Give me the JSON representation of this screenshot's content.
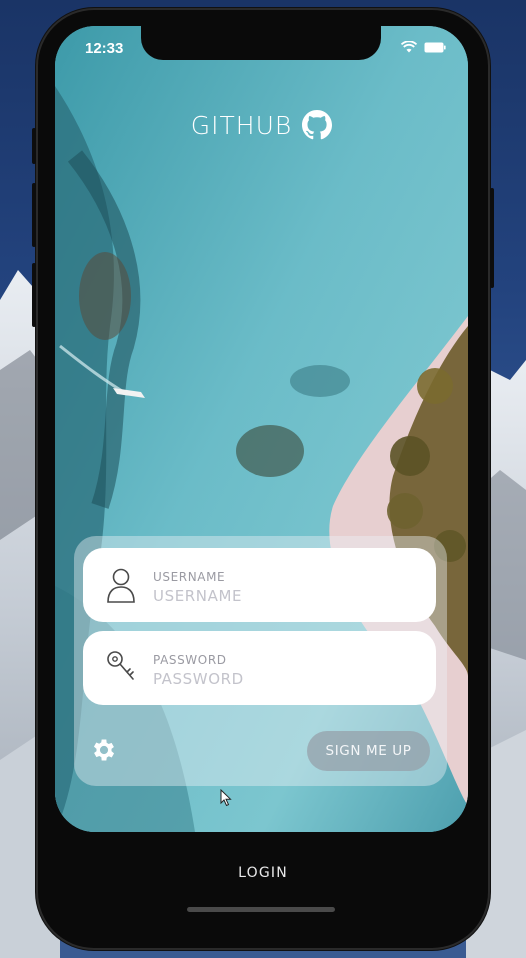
{
  "status": {
    "time": "12:33",
    "wifi_icon": "wifi-icon",
    "battery_icon": "battery-icon"
  },
  "brand": {
    "title": "GITHUB",
    "logo_icon": "github-logo-icon"
  },
  "login_form": {
    "username": {
      "label": "USERNAME",
      "placeholder": "USERNAME",
      "value": "",
      "icon": "user-icon"
    },
    "password": {
      "label": "PASSWORD",
      "placeholder": "PASSWORD",
      "value": "",
      "icon": "key-icon"
    },
    "settings_icon": "gear-icon",
    "signup_label": "SIGN ME UP"
  },
  "bottom_bar": {
    "login_label": "LOGIN"
  },
  "colors": {
    "panel": "#e6ecf1",
    "button": "#9aa3ab",
    "phone_frame": "#0a0a0a",
    "water": "#5fb3c4",
    "sand": "#e7cfd0"
  }
}
